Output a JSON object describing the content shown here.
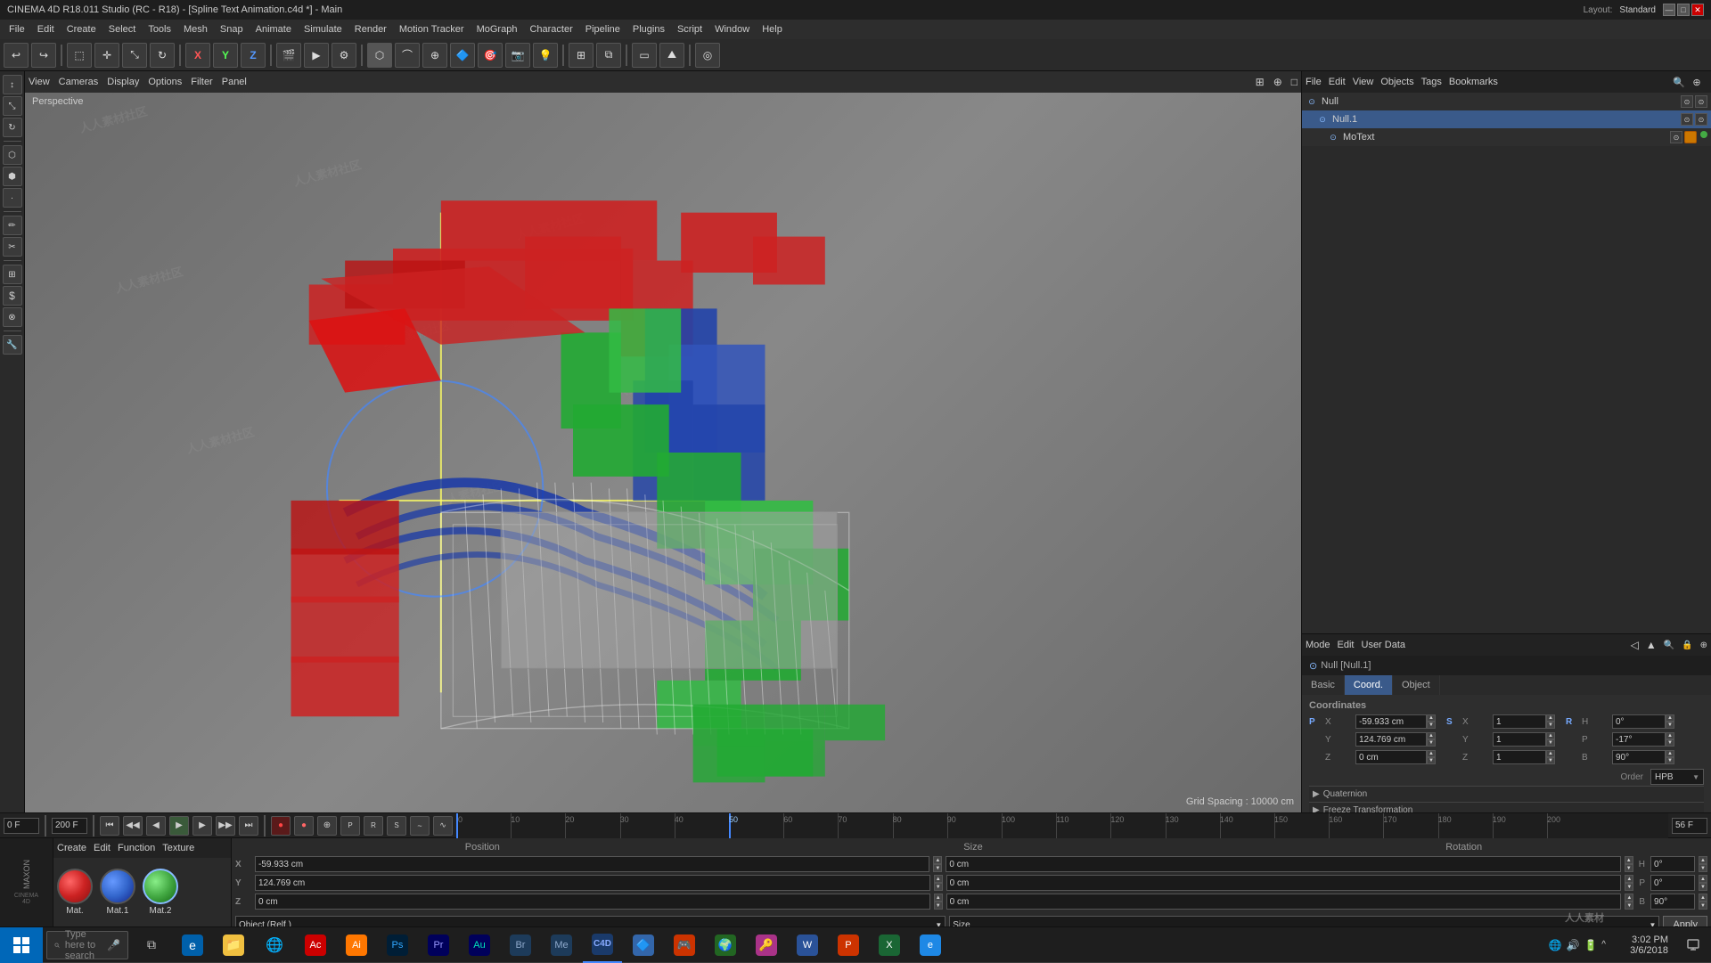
{
  "titlebar": {
    "title": "CINEMA 4D R18.011 Studio (RC - R18) - [Spline Text Animation.c4d *] - Main",
    "layout_label": "Layout:",
    "layout_value": "Standard",
    "controls": [
      "—",
      "□",
      "✕"
    ]
  },
  "menubar": {
    "items": [
      "File",
      "Edit",
      "Create",
      "Select",
      "Tools",
      "Mesh",
      "Snap",
      "Animate",
      "Simulate",
      "Render",
      "Motion Tracker",
      "MoGraph",
      "Character",
      "Pipeline",
      "Plugins",
      "Script",
      "Window",
      "Help"
    ]
  },
  "toolbar": {
    "buttons": [
      "↩",
      "↪",
      "🔲",
      "↕",
      "⊙",
      "⊕",
      "X",
      "Y",
      "Z",
      "🔷",
      "🔷",
      "🔷",
      "🔷",
      "🔷",
      "🎬",
      "🎬",
      "🔷",
      "🔷",
      "🔷",
      "🔷",
      "🔷",
      "🔷",
      "🔷",
      "🔷",
      "🔷",
      "🔷",
      "🔷",
      "🔷",
      "🔷",
      "🔷",
      "🔷",
      "💡"
    ]
  },
  "left_tools": {
    "buttons": [
      "▲",
      "↕",
      "⊙",
      "⬡",
      "⬢",
      "✏",
      "✂",
      "⊞",
      "$",
      "⊗",
      "🔧"
    ]
  },
  "viewport": {
    "toolbar_items": [
      "View",
      "Cameras",
      "Display",
      "Options",
      "Filter",
      "Panel"
    ],
    "perspective_label": "Perspective",
    "grid_label": "Grid Spacing : 10000 cm",
    "corner_icons": [
      "⊞",
      "⊕",
      "□"
    ]
  },
  "object_manager": {
    "toolbar_items": [
      "File",
      "Edit",
      "View",
      "Objects",
      "Tags",
      "Bookmarks"
    ],
    "objects": [
      {
        "name": "Null",
        "indent": 0,
        "tag": null,
        "icons": [
          "⊙",
          "⊙"
        ]
      },
      {
        "name": "Null.1",
        "indent": 1,
        "selected": true,
        "icons": [
          "⊙",
          "⊙"
        ]
      },
      {
        "name": "MoText",
        "indent": 2,
        "tag": "orange+green",
        "icons": [
          "⊙",
          "⊙"
        ]
      }
    ]
  },
  "attribute_panel": {
    "toolbar_items": [
      "Mode",
      "Edit",
      "User Data"
    ],
    "object_name": "Null [Null.1]",
    "tabs": [
      "Basic",
      "Coord.",
      "Object"
    ],
    "active_tab": "Coord.",
    "section_title": "Coordinates",
    "fields": {
      "position": {
        "X": {
          "value": "-59.933 cm",
          "arrows": true
        },
        "Y": {
          "value": "124.769 cm",
          "arrows": true
        },
        "Z": {
          "value": "0 cm",
          "arrows": true
        }
      },
      "scale": {
        "X": {
          "value": "1",
          "arrows": true
        },
        "Y": {
          "value": "1",
          "arrows": true
        },
        "Z": {
          "value": "1",
          "arrows": true
        }
      },
      "rotation": {
        "H": {
          "value": "0°",
          "arrows": true
        },
        "P": {
          "value": "-17°",
          "arrows": true
        },
        "B": {
          "value": "90°",
          "arrows": true
        }
      },
      "order": {
        "value": "HPB"
      }
    },
    "collapsible": [
      "Quaternion",
      "Freeze Transformation"
    ]
  },
  "timeline": {
    "current_frame": "0 F",
    "end_frame": "200 F",
    "fps": "56 F",
    "ticks": [
      0,
      10,
      20,
      30,
      40,
      50,
      60,
      70,
      80,
      90,
      100,
      110,
      120,
      130,
      140,
      150,
      160,
      170,
      180,
      190,
      200
    ],
    "highlighted_tick": 56,
    "buttons": [
      "⏮",
      "⏪",
      "⏴",
      "⏵",
      "⏩",
      "⏭",
      "⏺",
      "⏹",
      "⏸",
      "⊕",
      "⊗",
      "⊞",
      "⊟"
    ]
  },
  "bottom": {
    "material_toolbar": [
      "Create",
      "Edit",
      "Function",
      "Texture"
    ],
    "materials": [
      {
        "name": "Mat.",
        "color": "#cc2222"
      },
      {
        "name": "Mat.1",
        "color": "#3366cc"
      },
      {
        "name": "Mat.2",
        "color": "#44aa44",
        "selected": true
      }
    ],
    "position": {
      "headers": [
        "Position",
        "Size",
        "Rotation"
      ],
      "rows": [
        {
          "coord": "X",
          "pos": "-59.933 cm",
          "size": "0 cm",
          "rot": {
            "label": "H",
            "value": "0°"
          }
        },
        {
          "coord": "Y",
          "pos": "124.769 cm",
          "size": "0 cm",
          "rot": {
            "label": "P",
            "value": "0°"
          }
        },
        {
          "coord": "Z",
          "pos": "0 cm",
          "size": "0 cm",
          "rot": {
            "label": "B",
            "value": "90°"
          }
        }
      ],
      "object_ref_label": "Object (Relf.)",
      "size_label": "Size",
      "apply_label": "Apply"
    }
  },
  "taskbar": {
    "search_placeholder": "Type here to search",
    "apps": [
      "🪟",
      "📋",
      "🌐",
      "📁",
      "🌍",
      "📄",
      "Ai",
      "Ps",
      "Pr",
      "Au",
      "Br",
      "🎵",
      "Me",
      "📧",
      "🔷",
      "📊",
      "🎮",
      "📦",
      "🌐",
      "🔑",
      "📝",
      "W",
      "P",
      "X",
      "E"
    ],
    "time": "3:02 PM",
    "date": "3/6/2018"
  },
  "colors": {
    "accent": "#3a5a8a",
    "active_tab": "#3a5a8a",
    "mat_red": "#cc2222",
    "mat_blue": "#3366cc",
    "mat_green": "#44aa44",
    "c4d_blue": "#0066cc"
  }
}
